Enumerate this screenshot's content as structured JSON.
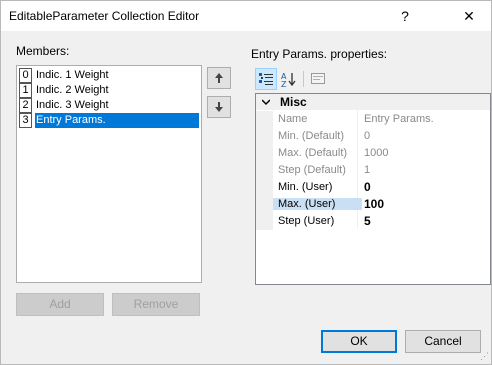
{
  "window": {
    "title": "EditableParameter Collection Editor",
    "help_glyph": "?",
    "close_glyph": "✕"
  },
  "members": {
    "label": "Members:",
    "items": [
      {
        "index": "0",
        "label": "Indic. 1 Weight"
      },
      {
        "index": "1",
        "label": "Indic. 2 Weight"
      },
      {
        "index": "2",
        "label": "Indic. 3 Weight"
      },
      {
        "index": "3",
        "label": "Entry Params.",
        "selected": true
      }
    ],
    "add_label": "Add",
    "remove_label": "Remove"
  },
  "properties": {
    "label": "Entry Params. properties:",
    "category": "Misc",
    "rows": [
      {
        "name": "Name",
        "value": "Entry Params.",
        "readonly": true
      },
      {
        "name": "Min. (Default)",
        "value": "0",
        "readonly": true
      },
      {
        "name": "Max. (Default)",
        "value": "1000",
        "readonly": true
      },
      {
        "name": "Step (Default)",
        "value": "1",
        "readonly": true
      },
      {
        "name": "Min. (User)",
        "value": "0",
        "readonly": false
      },
      {
        "name": "Max. (User)",
        "value": "100",
        "readonly": false,
        "selected": true
      },
      {
        "name": "Step (User)",
        "value": "5",
        "readonly": false
      }
    ]
  },
  "footer": {
    "ok_label": "OK",
    "cancel_label": "Cancel"
  },
  "icons": {
    "move_up": "arrow-up-icon",
    "move_down": "arrow-down-icon",
    "categorized": "categorized-icon",
    "alphabetical": "sort-alphabetical-icon",
    "property_pages": "property-pages-icon"
  },
  "colors": {
    "selection": "#0078d7",
    "default_button_border": "#0078d7"
  }
}
